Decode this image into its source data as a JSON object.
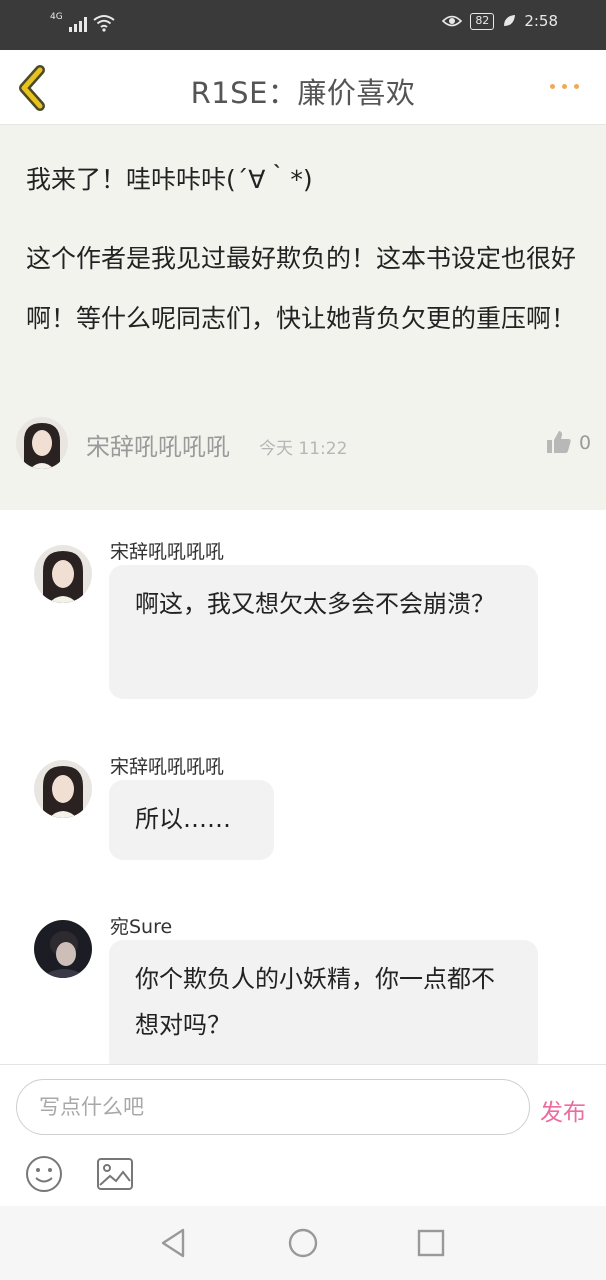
{
  "status_bar": {
    "network": "4G",
    "battery": "82",
    "time": "2:58",
    "icons": [
      "signal-icon",
      "wifi-icon",
      "eye-icon",
      "battery-icon",
      "leaf-icon"
    ]
  },
  "header": {
    "title": "R1SE：廉价喜欢",
    "back_icon": "chevron-left-icon",
    "more_icon": "more-dots-icon"
  },
  "post": {
    "text_1": "我来了！哇咔咔咔(´∀｀*)",
    "text_2": "这个作者是我见过最好欺负的！这本书设定也很好啊！等什么呢同志们，快让她背负欠更的重压啊！",
    "author": "宋辞吼吼吼吼",
    "time": "今天 11:22",
    "like_count": "0"
  },
  "replies": [
    {
      "author": "宋辞吼吼吼吼",
      "text": "啊这，我又想欠太多会不会崩溃？"
    },
    {
      "author": "宋辞吼吼吼吼",
      "text": "所以……"
    },
    {
      "author": "宛Sure",
      "text": "你个欺负人的小妖精，你一点都不想对吗？"
    }
  ],
  "composer": {
    "placeholder": "写点什么吧",
    "publish_label": "发布",
    "emoji_icon": "emoji-icon",
    "image_icon": "image-icon"
  },
  "navigation": {
    "icons": [
      "nav-back-icon",
      "nav-home-icon",
      "nav-recent-icon"
    ]
  },
  "colors": {
    "accent_pink": "#ec6ca0",
    "accent_orange": "#f0a85a",
    "back_arrow_yellow": "#e8c21f",
    "post_background": "#f3f3ee"
  }
}
